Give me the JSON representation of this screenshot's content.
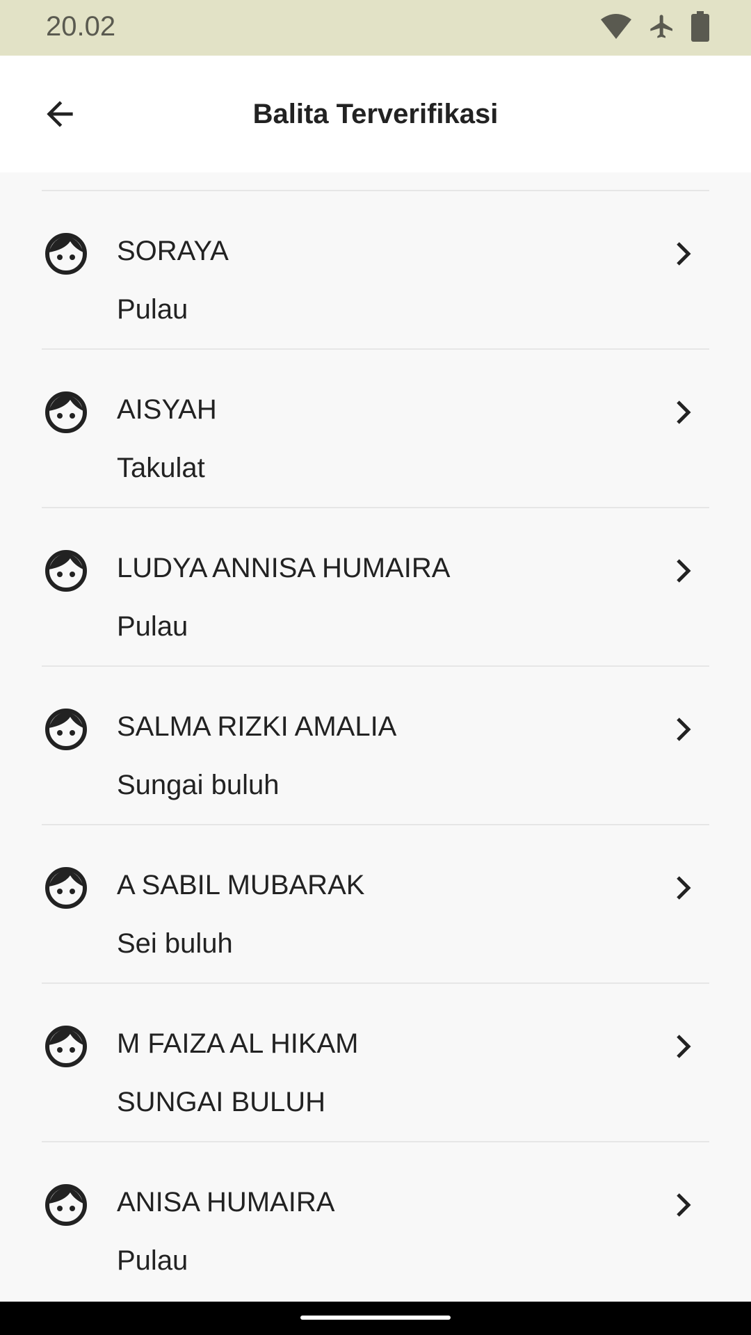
{
  "status_bar": {
    "time": "20.02",
    "icons": [
      "wifi-icon",
      "airplane-mode-icon",
      "battery-icon"
    ]
  },
  "app_bar": {
    "title": "Balita Terverifikasi",
    "back_icon": "arrow-back-icon"
  },
  "items": [
    {
      "name": "SORAYA",
      "location": "Pulau"
    },
    {
      "name": "AISYAH",
      "location": "Takulat"
    },
    {
      "name": "LUDYA ANNISA HUMAIRA",
      "location": "Pulau"
    },
    {
      "name": "SALMA RIZKI AMALIA",
      "location": "Sungai buluh"
    },
    {
      "name": "A SABIL MUBARAK",
      "location": "Sei buluh"
    },
    {
      "name": "M FAIZA AL HIKAM",
      "location": "SUNGAI BULUH"
    },
    {
      "name": "ANISA HUMAIRA",
      "location": "Pulau"
    }
  ],
  "colors": {
    "status_bar_bg": "#e2e2c6",
    "app_bar_bg": "#ffffff",
    "list_bg": "#f8f8f8",
    "text": "#222222",
    "divider": "#e6e6e6"
  }
}
